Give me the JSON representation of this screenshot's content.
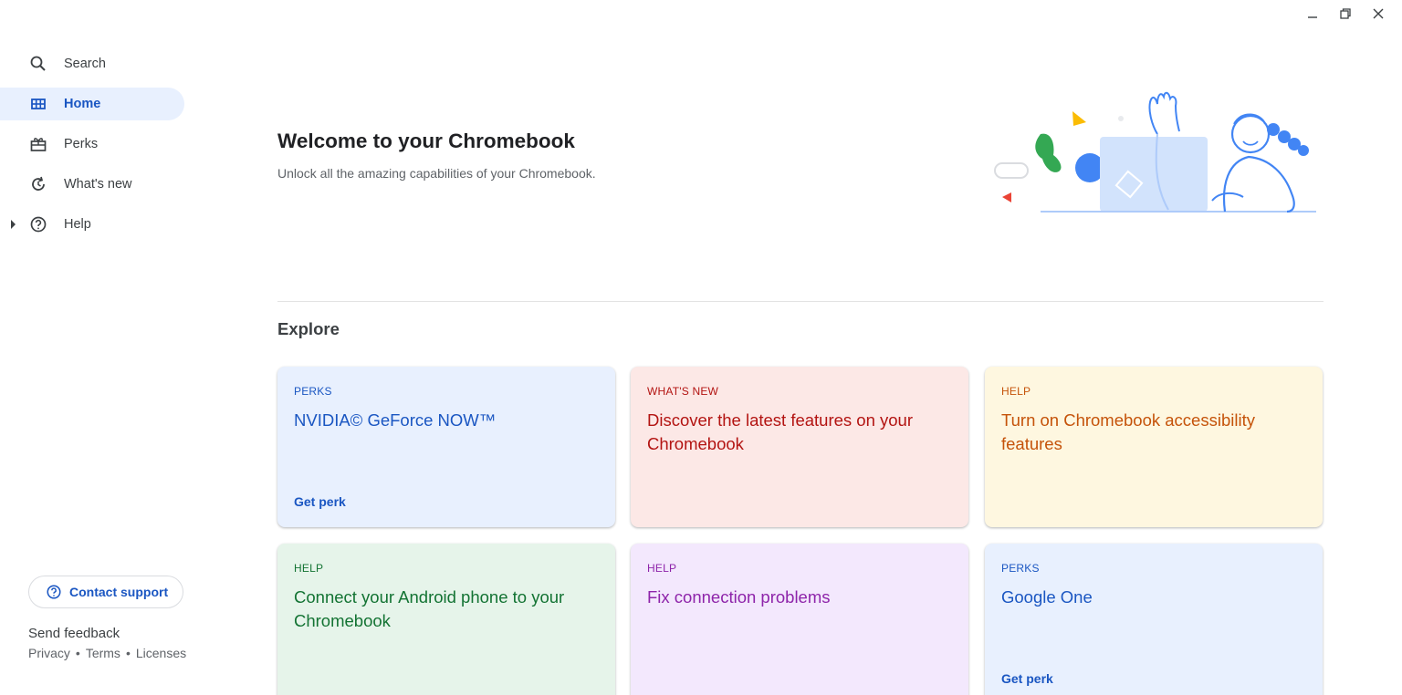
{
  "window": {
    "controls": [
      "minimize-icon",
      "restore-icon",
      "close-icon"
    ]
  },
  "sidebar": {
    "items": [
      {
        "label": "Search",
        "icon": "search-icon"
      },
      {
        "label": "Home",
        "icon": "home-grid-icon",
        "active": true
      },
      {
        "label": "Perks",
        "icon": "gift-icon"
      },
      {
        "label": "What's new",
        "icon": "refresh-icon"
      },
      {
        "label": "Help",
        "icon": "help-icon",
        "expandable": true
      }
    ],
    "contact_support": "Contact support",
    "send_feedback": "Send feedback",
    "legal": {
      "privacy": "Privacy",
      "terms": "Terms",
      "licenses": "Licenses",
      "separator": "•"
    }
  },
  "main": {
    "welcome_title": "Welcome to your Chromebook",
    "welcome_subtitle": "Unlock all the amazing capabilities of your Chromebook.",
    "explore_heading": "Explore",
    "cards": [
      {
        "category": "PERKS",
        "title": "NVIDIA© GeForce NOW™",
        "action": "Get perk"
      },
      {
        "category": "WHAT'S NEW",
        "title": "Discover the latest features on your Chromebook",
        "action": ""
      },
      {
        "category": "HELP",
        "title": "Turn on Chromebook accessibility features",
        "action": ""
      },
      {
        "category": "HELP",
        "title": "Connect your Android phone to your Chromebook",
        "action": ""
      },
      {
        "category": "HELP",
        "title": "Fix connection problems",
        "action": ""
      },
      {
        "category": "PERKS",
        "title": "Google One",
        "action": "Get perk"
      }
    ]
  },
  "colors": {
    "accent_blue": "#1a56c2",
    "active_bg": "#e8f0fe",
    "card_blue": "#e8f0fe",
    "card_red": "#fce8e6",
    "card_yellow": "#fef7e0",
    "card_green": "#e6f4ea",
    "card_purple": "#f3e8fd"
  }
}
